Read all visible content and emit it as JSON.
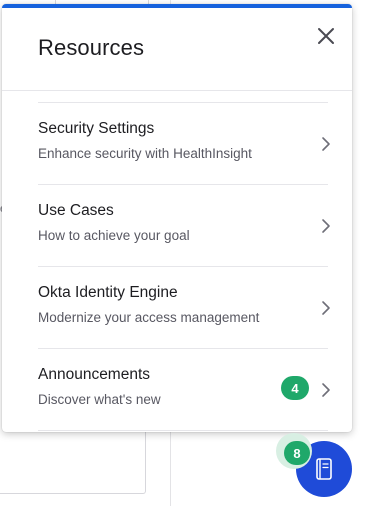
{
  "background": {
    "fragment_text": "e"
  },
  "panel": {
    "title": "Resources",
    "accent_color": "#1662dd",
    "items": [
      {
        "title": "Security Settings",
        "subtitle": "Enhance security with HealthInsight",
        "badge": null
      },
      {
        "title": "Use Cases",
        "subtitle": "How to achieve your goal",
        "badge": null
      },
      {
        "title": "Okta Identity Engine",
        "subtitle": "Modernize your access management",
        "badge": null
      },
      {
        "title": "Announcements",
        "subtitle": "Discover what's new",
        "badge": "4"
      }
    ]
  },
  "launcher": {
    "badge": "8",
    "color": "#1f4bd8",
    "badge_color": "#1fa86a",
    "icon": "book-icon"
  }
}
